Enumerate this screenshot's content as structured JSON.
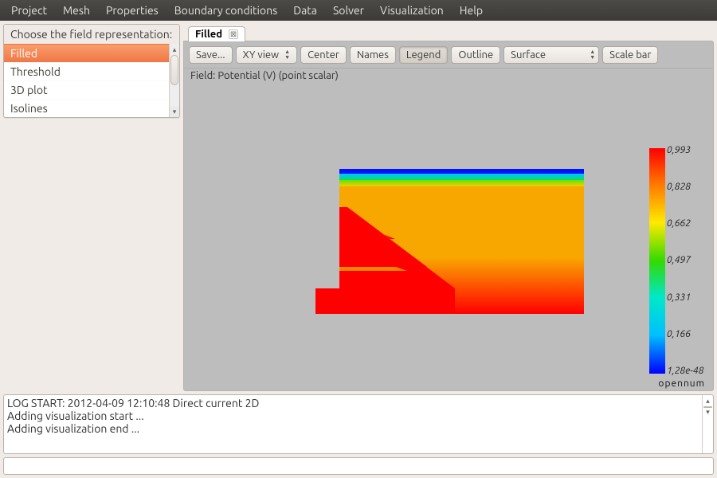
{
  "menubar": [
    "Project",
    "Mesh",
    "Properties",
    "Boundary conditions",
    "Data",
    "Solver",
    "Visualization",
    "Help"
  ],
  "side": {
    "title": "Choose the field representation:",
    "items": [
      "Filled",
      "Threshold",
      "3D plot",
      "Isolines"
    ],
    "selected_index": 0
  },
  "tab": {
    "label": "Filled"
  },
  "toolbar": {
    "save": "Save...",
    "xyview": "XY view",
    "center": "Center",
    "names": "Names",
    "legend": "Legend",
    "outline": "Outline",
    "surface_select": "Surface",
    "scalebar": "Scale bar",
    "legend_active": true
  },
  "fieldline": "Field:  Potential (V) (point scalar)",
  "colorbar": {
    "labels": [
      "0,993",
      "0,828",
      "0,662",
      "0,497",
      "0,331",
      "0,166",
      "1,28e-48"
    ]
  },
  "watermark": "opennum",
  "log_lines": [
    "LOG START: 2012-04-09 12:10:48 Direct current 2D",
    "Adding visualization start ...",
    "Adding visualization end ..."
  ],
  "chart_data": {
    "type": "heatmap",
    "title": "Potential (V) (point scalar)",
    "field_name": "Potential",
    "field_unit": "V",
    "field_kind": "point scalar",
    "value_range": [
      1.28e-48,
      0.993
    ],
    "colormap": "jet_reversed",
    "colorbar_ticks": [
      0.993,
      0.828,
      0.662,
      0.497,
      0.331,
      0.166,
      1.28e-48
    ]
  }
}
